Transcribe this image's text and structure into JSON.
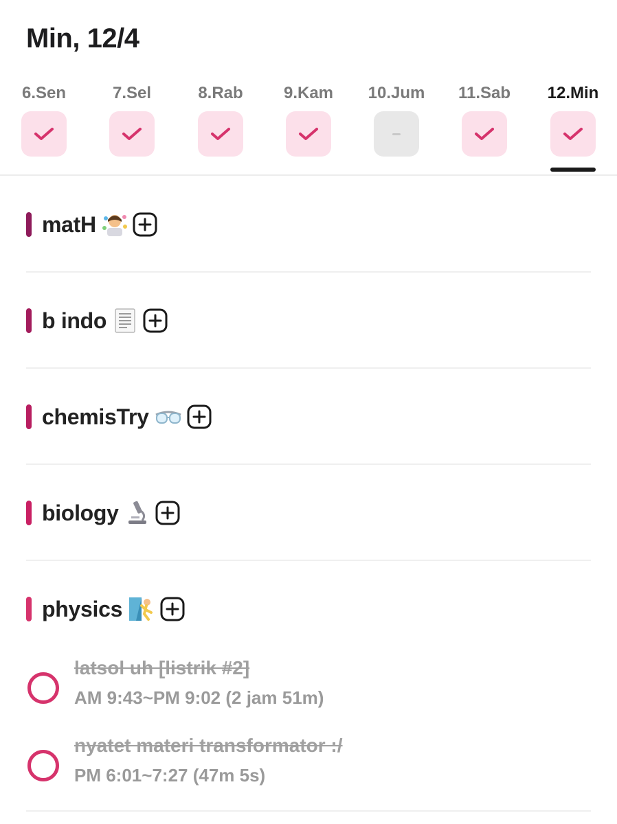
{
  "header": {
    "title": "Min, 12/4"
  },
  "week": [
    {
      "label": "6.Sen",
      "status": "done"
    },
    {
      "label": "7.Sel",
      "status": "done"
    },
    {
      "label": "8.Rab",
      "status": "done"
    },
    {
      "label": "9.Kam",
      "status": "done"
    },
    {
      "label": "10.Jum",
      "status": "empty"
    },
    {
      "label": "11.Sab",
      "status": "done"
    },
    {
      "label": "12.Min",
      "status": "done",
      "selected": true
    }
  ],
  "sections": [
    {
      "name": "matH",
      "bar_color": "#8e1b5a",
      "icon": "student-emoji-icon"
    },
    {
      "name": "b indo",
      "bar_color": "#a31c5c",
      "icon": "page-document-icon"
    },
    {
      "name": "chemisTry",
      "bar_color": "#b81e60",
      "icon": "goggles-icon"
    },
    {
      "name": "biology",
      "bar_color": "#c92063",
      "icon": "microscope-icon"
    },
    {
      "name": "physics",
      "bar_color": "#d6336c",
      "icon": "climber-icon",
      "tasks": [
        {
          "title": "latsol uh [listrik #2]",
          "time": "AM 9:43~PM 9:02 (2 jam 51m)"
        },
        {
          "title": "nyatet materi transformator :/",
          "time": "PM 6:01~7:27 (47m 5s)"
        }
      ]
    }
  ],
  "colors": {
    "accent": "#d6336c",
    "check_bg": "#fce0ea",
    "empty_bg": "#e8e8e8"
  }
}
